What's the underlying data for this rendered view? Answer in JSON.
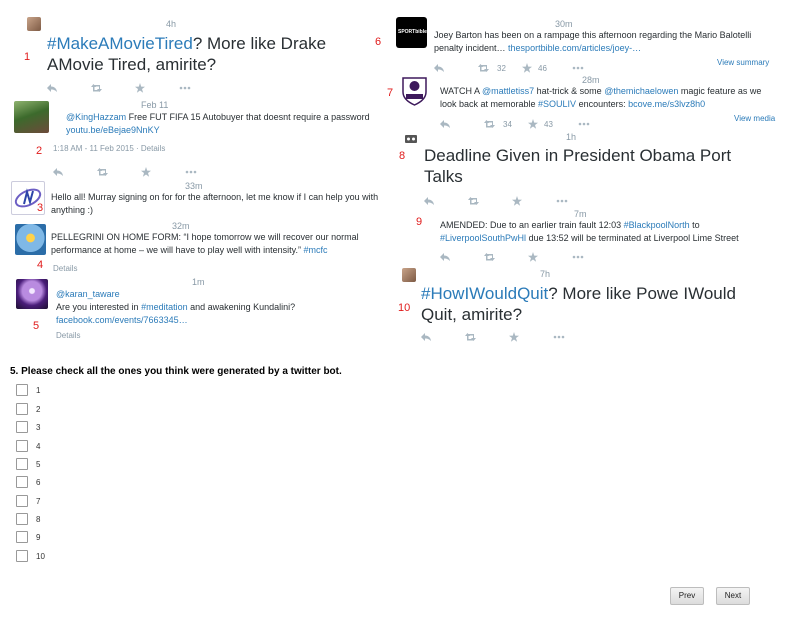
{
  "tweets": [
    {
      "num": "1",
      "time": "4h",
      "hashtag": "#MakeAMovieTired",
      "text": "? More like Drake AMovie Tired, amirite?"
    },
    {
      "num": "2",
      "time": "Feb 11",
      "mention": "@KingHazzam",
      "text": " Free FUT FIFA 15 Autobuyer that doesnt require a password ",
      "link": "youtu.be/eBejae9NnKY",
      "meta_date": "1:18 AM - 11 Feb 2015",
      "meta_sep": " · ",
      "meta_details": "Details"
    },
    {
      "num": "3",
      "time": "33m",
      "text": "Hello all! Murray signing on for for the afternoon, let me know if I can help you with anything :)"
    },
    {
      "num": "4",
      "time": "32m",
      "text": "PELLEGRINI ON HOME FORM: “I hope tomorrow we will recover our normal performance at home – we will have to play well with intensity.” ",
      "hashtag": "#mcfc",
      "details": "Details"
    },
    {
      "num": "5",
      "time": "1m",
      "mention": "@karan_taware",
      "text_a": "Are you interested in ",
      "hashtag": "#meditation",
      "text_b": " and awakening Kundalini? ",
      "link": "facebook.com/events/7663345…",
      "details": "Details"
    },
    {
      "num": "6",
      "time": "30m",
      "text": "Joey Barton has been on a rampage this afternoon regarding the Mario Balotelli penalty incident… ",
      "link": "thesportbible.com/articles/joey-…",
      "retweets": "32",
      "favorites": "46",
      "view": "View summary"
    },
    {
      "num": "7",
      "time": "28m",
      "text_a": "WATCH A ",
      "mention_a": "@mattletiss7",
      "text_b": " hat-trick & some ",
      "mention_b": "@themichaelowen",
      "text_c": " magic feature as we look back at memorable ",
      "hashtag": "#SOULIV",
      "text_d": " encounters: ",
      "link": "bcove.me/s3lvz8h0",
      "retweets": "34",
      "favorites": "43",
      "view": "View media"
    },
    {
      "num": "8",
      "time": "1h",
      "text": "Deadline Given in President Obama Port Talks"
    },
    {
      "num": "9",
      "time": "7m",
      "text_a": "AMENDED: Due to an earlier train fault 12:03 ",
      "hashtag_a": "#BlackpoolNorth",
      "text_b": " to ",
      "hashtag_b": "#LiverpoolSouthPwHl",
      "text_c": " due 13:52 will be terminated at Liverpool Lime Street"
    },
    {
      "num": "10",
      "time": "7h",
      "hashtag": "#HowIWouldQuit",
      "text": "? More like Powe IWould Quit, amirite?"
    }
  ],
  "question": {
    "title": "5. Please check all the ones you think were generated by a twitter bot.",
    "options": [
      "1",
      "2",
      "3",
      "4",
      "5",
      "6",
      "7",
      "8",
      "9",
      "10"
    ]
  },
  "nav": {
    "prev": "Prev",
    "next": "Next"
  },
  "colors": {
    "link": "#2b7bb9",
    "number": "#e01b1b",
    "muted": "#8899a6"
  },
  "icons": [
    "reply-icon",
    "retweet-icon",
    "favorite-icon",
    "more-icon"
  ]
}
